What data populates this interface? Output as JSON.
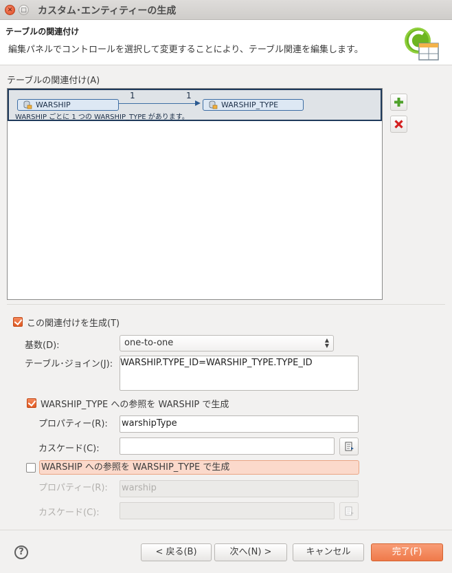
{
  "window": {
    "title": "カスタム･エンティティーの生成"
  },
  "header": {
    "title": "テーブルの関連付け",
    "description": "編集パネルでコントロールを選択して変更することにより、テーブル関連を編集します。"
  },
  "associations": {
    "label": "テーブルの関連付け(A)",
    "items": [
      {
        "source": "WARSHIP",
        "target": "WARSHIP_TYPE",
        "source_card": "1",
        "target_card": "1",
        "description": "WARSHIP ごとに 1 つの WARSHIP_TYPE があります。"
      }
    ]
  },
  "form": {
    "generate_label": "この関連付けを生成(T)",
    "generate_checked": true,
    "cardinality_label": "基数(D):",
    "cardinality_value": "one-to-one",
    "join_label": "テーブル･ジョイン(J):",
    "join_value": "WARSHIP.TYPE_ID=WARSHIP_TYPE.TYPE_ID",
    "ref1": {
      "label": "WARSHIP_TYPE への参照を WARSHIP で生成",
      "checked": true,
      "property_label": "プロパティー(R):",
      "property_value": "warshipType",
      "cascade_label": "カスケード(C):",
      "cascade_value": ""
    },
    "ref2": {
      "label": "WARSHIP への参照を WARSHIP_TYPE で生成",
      "checked": false,
      "property_label": "プロパティー(R):",
      "property_value": "warship",
      "cascade_label": "カスケード(C):",
      "cascade_value": ""
    }
  },
  "footer": {
    "help": "?",
    "back": "< 戻る(B)",
    "next": "次へ(N) >",
    "cancel": "キャンセル",
    "finish": "完了(F)"
  },
  "colors": {
    "accent": "#ef7a4a",
    "selection_border": "#1f3a5c",
    "entity_fill": "#dde8f4"
  }
}
